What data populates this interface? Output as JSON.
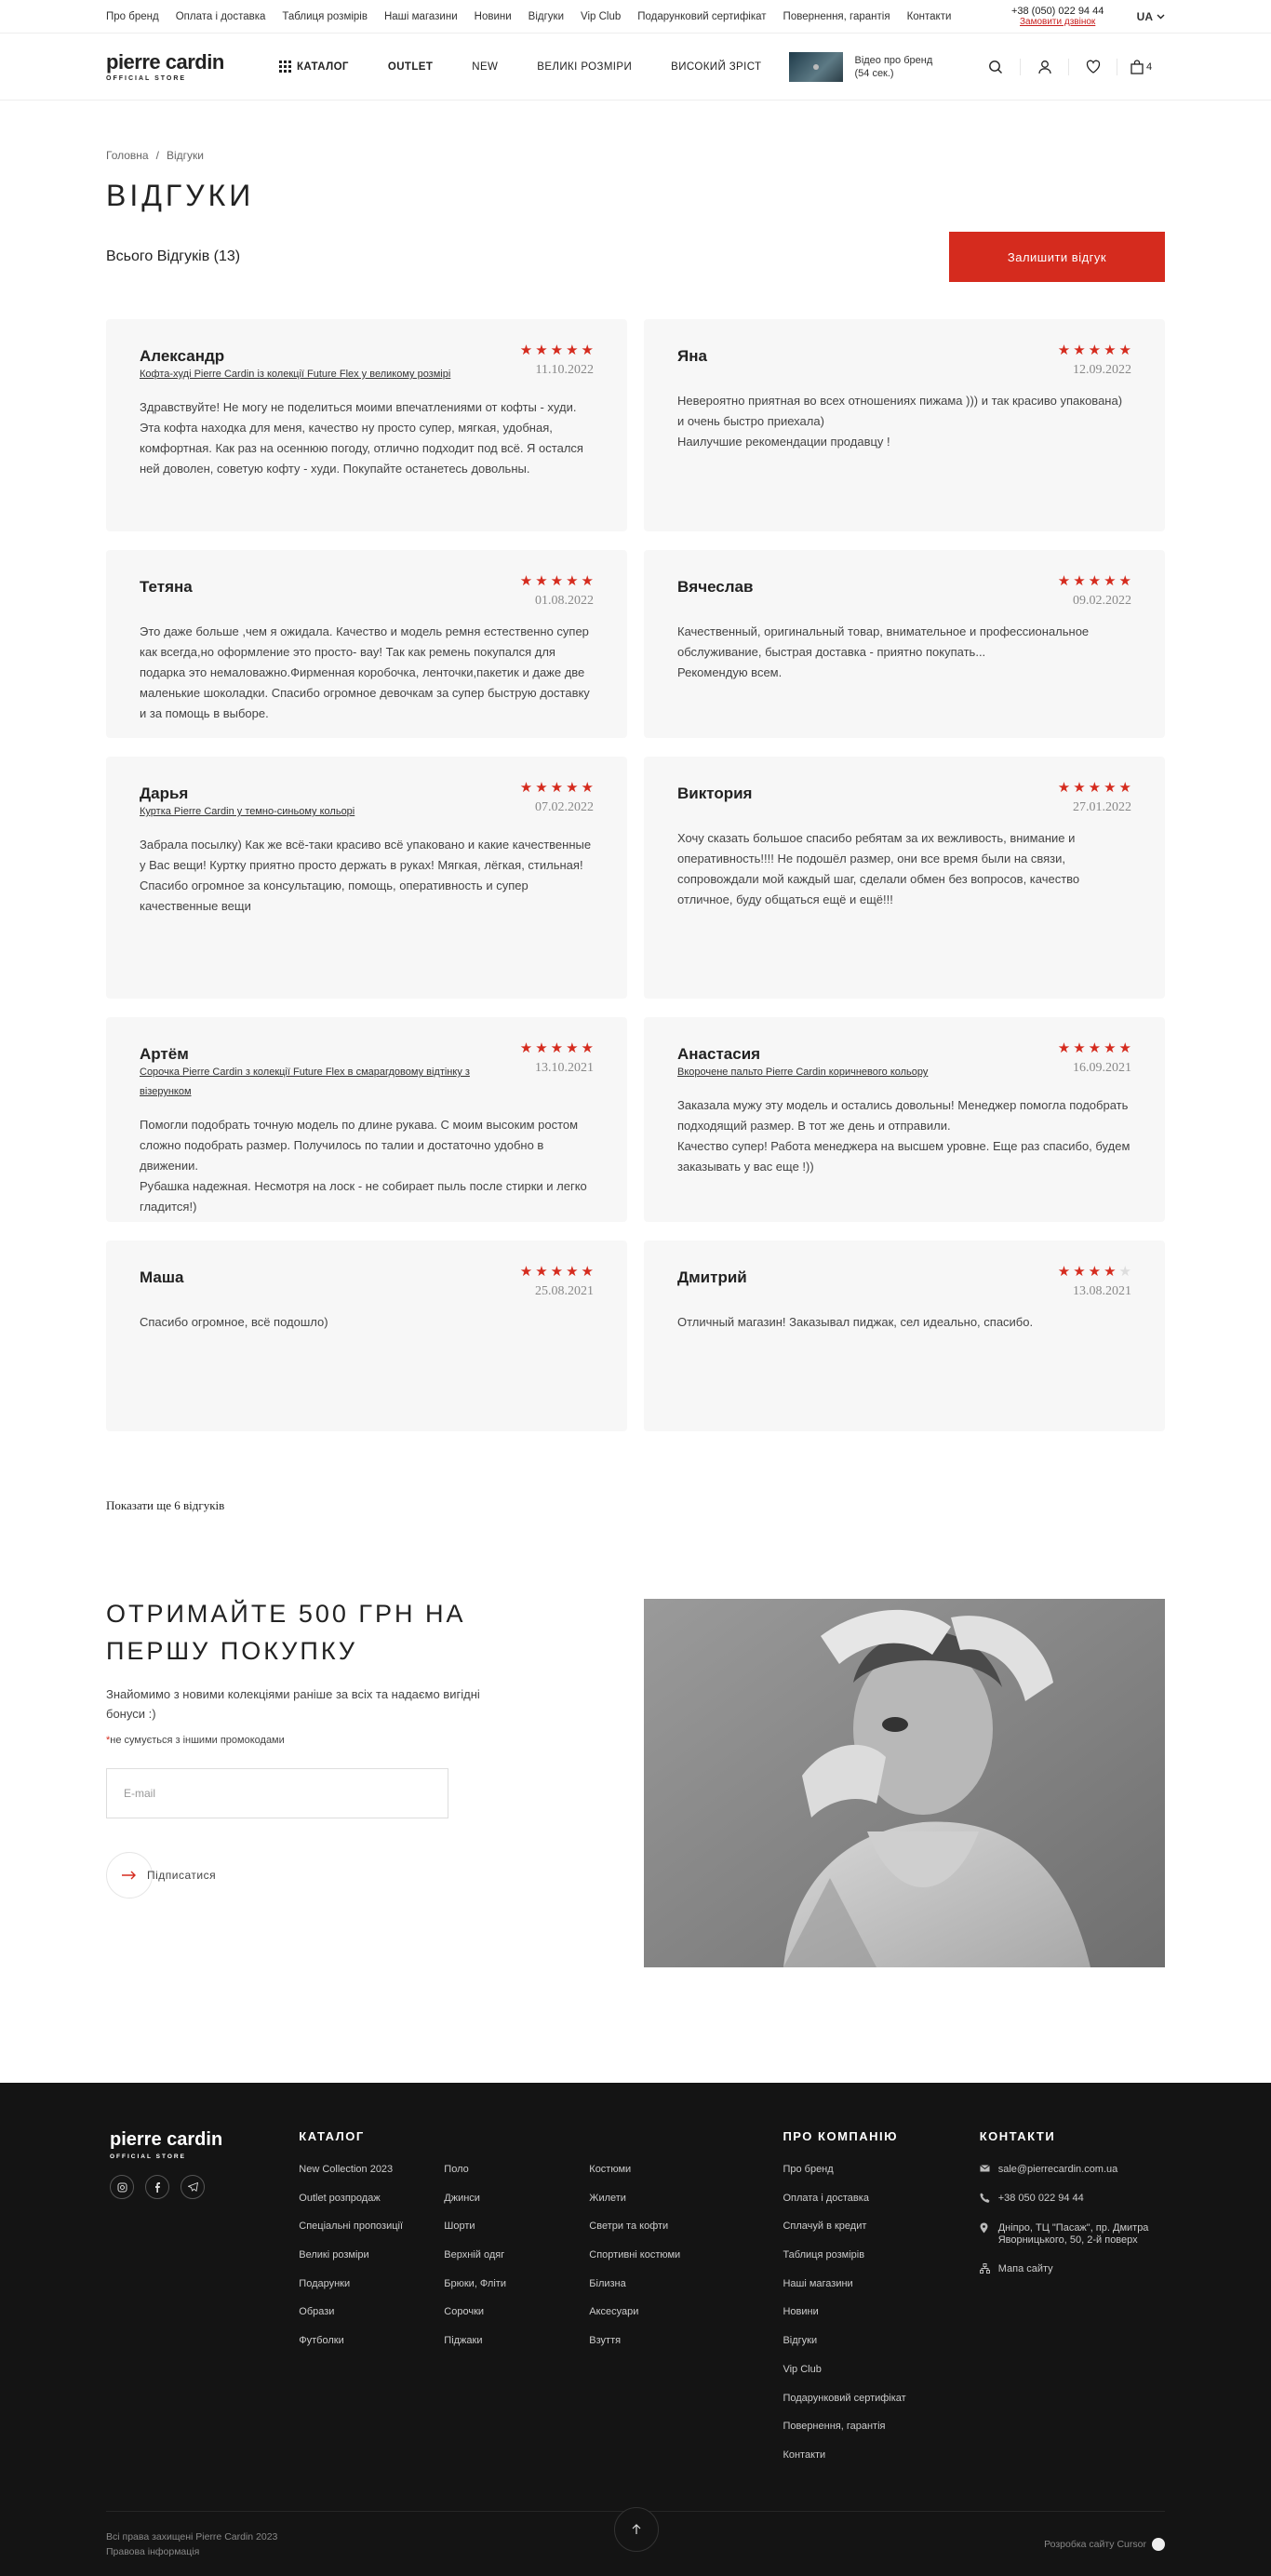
{
  "topbar": {
    "links": [
      "Про бренд",
      "Оплата і доставка",
      "Таблиця розмірів",
      "Наші магазини",
      "Новини",
      "Відгуки",
      "Vip Club",
      "Подарунковий сертифікат",
      "Повернення, гарантія",
      "Контакти"
    ],
    "phone": "+38 (050) 022 94 44",
    "callback": "Замовити дзвінок",
    "lang": "UA"
  },
  "header": {
    "logo_brand": "pierre cardin",
    "logo_sub": "OFFICIAL STORE",
    "nav": {
      "catalog": "КАТАЛОГ",
      "outlet": "OUTLET",
      "new": "NEW",
      "big": "ВЕЛИКІ РОЗМІРИ",
      "tall": "ВИСОКИЙ ЗРІСТ"
    },
    "video_line1": "Відео про бренд",
    "video_line2": "(54 сек.)",
    "cart_count": "4"
  },
  "breadcrumb": {
    "home": "Головна",
    "sep": "/",
    "current": "Відгуки"
  },
  "page_title": "ВІДГУКИ",
  "reviews_count": "Всього Відгуків (13)",
  "leave_review": "Залишити відгук",
  "reviews": [
    {
      "name": "Александр",
      "rating": 5,
      "date": "11.10.2022",
      "product": "Кофта-худі Pierre Cardin із колекції Future Flex у великому розмірі",
      "text": "Здравствуйте! Не могу не поделиться моими впечатлениями от  кофты - худи. Эта кофта находка для меня, качество ну просто супер, мягкая, удобная, комфортная. Как раз на осеннюю погоду, отлично подходит под всё. Я остался ней доволен, советую кофту - худи. Покупайте останетесь довольны."
    },
    {
      "name": "Яна",
      "rating": 5,
      "date": "12.09.2022",
      "product": "",
      "text": "Невероятно приятная во всех отношениях  пижама )))  и так красиво упакована) и очень быстро приехала)\nНаилучшие рекомендации продавцу !"
    },
    {
      "name": "Тетяна",
      "rating": 5,
      "date": "01.08.2022",
      "product": "",
      "text": "Это даже больше ,чем я ожидала. Качество и модель ремня естественно супер как всегда,но оформление это просто- вау!  Так как ремень покупался для подарка это немаловажно.Фирменная коробочка, ленточки,пакетик и даже две маленькие шоколадки. Спасибо огромное девочкам за супер быструю доставку и за помощь в выборе."
    },
    {
      "name": "Вячеслав",
      "rating": 5,
      "date": "09.02.2022",
      "product": "",
      "text": "Качественный, оригинальный товар, внимательное и профессиональное обслуживание, быстрая доставка - приятно покупать...\nРекомендую всем."
    },
    {
      "name": "Дарья",
      "rating": 5,
      "date": "07.02.2022",
      "product": "Куртка Pierre Cardin у темно-синьому кольорі",
      "text": "Забрала посылку) Как же всё-таки красиво всё упаковано и какие качественные у Вас вещи! Куртку приятно просто держать в руках! Мягкая, лёгкая, стильная!  Спасибо огромное за консультацию, помощь, оперативность и супер качественные вещи"
    },
    {
      "name": "Виктория",
      "rating": 5,
      "date": "27.01.2022",
      "product": "",
      "text": "Хочу сказать большое спасибо ребятам  за их вежливость, внимание и оперативность!!!! Не подошёл размер, они все время были на связи, сопровождали мой каждый шаг,  сделали обмен без вопросов, качество отличное, буду общаться ещё и ещё!!!"
    },
    {
      "name": "Артём",
      "rating": 5,
      "date": "13.10.2021",
      "product": "Сорочка Pierre Cardin з колекції Future Flex в смарагдовому відтінку з візерунком",
      "text": "Помогли подобрать точную модель по длине рукава. С моим высоким ростом сложно подобрать размер. Получилось по талии и достаточно удобно в движении.\nРубашка надежная. Несмотря на лоск - не собирает пыль после стирки и легко гладится!)"
    },
    {
      "name": "Анастасия",
      "rating": 5,
      "date": "16.09.2021",
      "product": "Вкорочене пальто Pierre Cardin коричневого кольору",
      "text": "Заказала мужу эту модель и остались довольны! Менеджер помогла подобрать подходящий размер. В тот же день и отправили.\nКачество супер! Работа менеджера на высшем уровне. Еще раз спасибо, будем заказывать у вас еще !))"
    },
    {
      "name": "Маша",
      "rating": 5,
      "date": "25.08.2021",
      "product": "",
      "text": "Спасибо огромное, всё подошло)"
    },
    {
      "name": "Дмитрий",
      "rating": 4,
      "date": "13.08.2021",
      "product": "",
      "text": "Отличный магазин! Заказывал пиджак, сел идеально, спасибо."
    }
  ],
  "show_more": "Показати ще 6 відгуків",
  "subscribe": {
    "title": "ОТРИМАЙТЕ 500 ГРН НА ПЕРШУ ПОКУПКУ",
    "desc": "Знайомимо з новими колекціями раніше за всіх та надаємо вигідні бонуси :)",
    "note_mark": "*",
    "note": "не сумується з іншими промокодами",
    "email_placeholder": "E-mail",
    "button": "Підписатися"
  },
  "footer": {
    "logo_brand": "pierre cardin",
    "logo_sub": "OFFICIAL STORE",
    "socials": [
      "instagram-icon",
      "facebook-icon",
      "telegram-icon"
    ],
    "catalog_title": "КАТАЛОГ",
    "catalog_cols": [
      [
        "New Collection 2023",
        "Outlet розпродаж",
        "Спеціальні пропозиції",
        "Великі розміри",
        "Подарунки",
        "Образи",
        "Футболки"
      ],
      [
        "Поло",
        "Джинси",
        "Шорти",
        "Верхній одяг",
        "Брюки, Фліти",
        "Сорочки",
        "Піджаки"
      ],
      [
        "Костюми",
        "Жилети",
        "Светри та кофти",
        "Спортивні костюми",
        "Білизна",
        "Аксесуари",
        "Взуття"
      ]
    ],
    "company_title": "ПРО КОМПАНІЮ",
    "company_links": [
      "Про бренд",
      "Оплата і доставка",
      "Сплачуй в кредит",
      "Таблиця розмірів",
      "Наші магазини",
      "Новини",
      "Відгуки",
      "Vip Club",
      "Подарунковий сертифікат",
      "Повернення, гарантія",
      "Контакти"
    ],
    "contacts_title": "КОНТАКТИ",
    "email": "sale@pierrecardin.com.ua",
    "phone": "+38 050 022 94 44",
    "address": "Дніпро, ТЦ \"Пасаж\", пр. Дмитра Яворницького, 50, 2-й поверх",
    "sitemap": "Мапа сайту",
    "rights": "Всі права захищені Pierre Cardin 2023",
    "legal": "Правова інформація",
    "developer": "Розробка сайту Cursor"
  },
  "colors": {
    "accent": "#d52b1e",
    "footer_bg": "#141414",
    "card_bg": "#f7f7f7"
  }
}
